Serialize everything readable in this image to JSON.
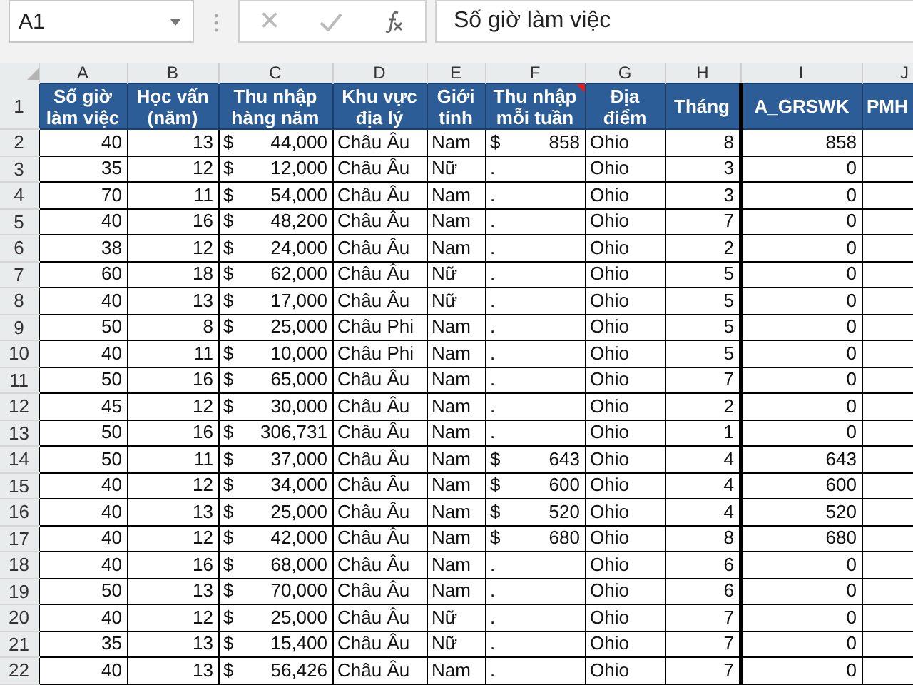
{
  "formula_bar": {
    "name_box": "A1",
    "cancel_icon": "×",
    "formula": "Số giờ làm việc"
  },
  "columns": [
    {
      "letter": "A",
      "heading": "Số giờ làm việc",
      "kind": "number"
    },
    {
      "letter": "B",
      "heading": "Học vấn (năm)",
      "kind": "number"
    },
    {
      "letter": "C",
      "heading": "Thu nhập hàng năm",
      "kind": "money"
    },
    {
      "letter": "D",
      "heading": "Khu vực địa lý",
      "kind": "text"
    },
    {
      "letter": "E",
      "heading": "Giới tính",
      "kind": "text"
    },
    {
      "letter": "F",
      "heading": "Thu nhập mỗi tuần",
      "kind": "money",
      "comment": true
    },
    {
      "letter": "G",
      "heading": "Địa điểm",
      "kind": "text"
    },
    {
      "letter": "H",
      "heading": "Tháng",
      "kind": "number"
    },
    {
      "letter": "I",
      "heading": "A_GRSWK",
      "kind": "number"
    },
    {
      "letter": "J",
      "heading": "PMH"
    }
  ],
  "header_row_number": "1",
  "rows": [
    {
      "num": "2",
      "cells": [
        [
          "40"
        ],
        [
          "13"
        ],
        [
          "$",
          "44,000"
        ],
        [
          "Châu Âu"
        ],
        [
          "Nam"
        ],
        [
          "$",
          "858"
        ],
        [
          "Ohio"
        ],
        [
          "8"
        ],
        [
          "858"
        ]
      ]
    },
    {
      "num": "3",
      "cells": [
        [
          "35"
        ],
        [
          "12"
        ],
        [
          "$",
          "12,000"
        ],
        [
          "Châu Âu"
        ],
        [
          "Nữ"
        ],
        [
          "."
        ],
        [
          "Ohio"
        ],
        [
          "3"
        ],
        [
          "0"
        ]
      ]
    },
    {
      "num": "4",
      "cells": [
        [
          "70"
        ],
        [
          "11"
        ],
        [
          "$",
          "54,000"
        ],
        [
          "Châu Âu"
        ],
        [
          "Nam"
        ],
        [
          "."
        ],
        [
          "Ohio"
        ],
        [
          "3"
        ],
        [
          "0"
        ]
      ]
    },
    {
      "num": "5",
      "cells": [
        [
          "40"
        ],
        [
          "16"
        ],
        [
          "$",
          "48,200"
        ],
        [
          "Châu Âu"
        ],
        [
          "Nam"
        ],
        [
          "."
        ],
        [
          "Ohio"
        ],
        [
          "7"
        ],
        [
          "0"
        ]
      ]
    },
    {
      "num": "6",
      "cells": [
        [
          "38"
        ],
        [
          "12"
        ],
        [
          "$",
          "24,000"
        ],
        [
          "Châu Âu"
        ],
        [
          "Nam"
        ],
        [
          "."
        ],
        [
          "Ohio"
        ],
        [
          "2"
        ],
        [
          "0"
        ]
      ]
    },
    {
      "num": "7",
      "cells": [
        [
          "60"
        ],
        [
          "18"
        ],
        [
          "$",
          "62,000"
        ],
        [
          "Châu Âu"
        ],
        [
          "Nữ"
        ],
        [
          "."
        ],
        [
          "Ohio"
        ],
        [
          "5"
        ],
        [
          "0"
        ]
      ]
    },
    {
      "num": "8",
      "cells": [
        [
          "40"
        ],
        [
          "13"
        ],
        [
          "$",
          "17,000"
        ],
        [
          "Châu Âu"
        ],
        [
          "Nữ"
        ],
        [
          "."
        ],
        [
          "Ohio"
        ],
        [
          "5"
        ],
        [
          "0"
        ]
      ]
    },
    {
      "num": "9",
      "cells": [
        [
          "50"
        ],
        [
          "8"
        ],
        [
          "$",
          "25,000"
        ],
        [
          "Châu Phi"
        ],
        [
          "Nam"
        ],
        [
          "."
        ],
        [
          "Ohio"
        ],
        [
          "5"
        ],
        [
          "0"
        ]
      ]
    },
    {
      "num": "10",
      "cells": [
        [
          "40"
        ],
        [
          "11"
        ],
        [
          "$",
          "10,000"
        ],
        [
          "Châu Phi"
        ],
        [
          "Nam"
        ],
        [
          "."
        ],
        [
          "Ohio"
        ],
        [
          "5"
        ],
        [
          "0"
        ]
      ]
    },
    {
      "num": "11",
      "cells": [
        [
          "50"
        ],
        [
          "16"
        ],
        [
          "$",
          "65,000"
        ],
        [
          "Châu Âu"
        ],
        [
          "Nam"
        ],
        [
          "."
        ],
        [
          "Ohio"
        ],
        [
          "7"
        ],
        [
          "0"
        ]
      ]
    },
    {
      "num": "12",
      "cells": [
        [
          "45"
        ],
        [
          "12"
        ],
        [
          "$",
          "30,000"
        ],
        [
          "Châu Âu"
        ],
        [
          "Nam"
        ],
        [
          "."
        ],
        [
          "Ohio"
        ],
        [
          "2"
        ],
        [
          "0"
        ]
      ]
    },
    {
      "num": "13",
      "cells": [
        [
          "50"
        ],
        [
          "16"
        ],
        [
          "$",
          "306,731"
        ],
        [
          "Châu Âu"
        ],
        [
          "Nam"
        ],
        [
          "."
        ],
        [
          "Ohio"
        ],
        [
          "1"
        ],
        [
          "0"
        ]
      ]
    },
    {
      "num": "14",
      "cells": [
        [
          "50"
        ],
        [
          "11"
        ],
        [
          "$",
          "37,000"
        ],
        [
          "Châu Âu"
        ],
        [
          "Nam"
        ],
        [
          "$",
          "643"
        ],
        [
          "Ohio"
        ],
        [
          "4"
        ],
        [
          "643"
        ]
      ]
    },
    {
      "num": "15",
      "cells": [
        [
          "40"
        ],
        [
          "12"
        ],
        [
          "$",
          "34,000"
        ],
        [
          "Châu Âu"
        ],
        [
          "Nam"
        ],
        [
          "$",
          "600"
        ],
        [
          "Ohio"
        ],
        [
          "4"
        ],
        [
          "600"
        ]
      ]
    },
    {
      "num": "16",
      "cells": [
        [
          "40"
        ],
        [
          "13"
        ],
        [
          "$",
          "25,000"
        ],
        [
          "Châu Âu"
        ],
        [
          "Nam"
        ],
        [
          "$",
          "520"
        ],
        [
          "Ohio"
        ],
        [
          "4"
        ],
        [
          "520"
        ]
      ]
    },
    {
      "num": "17",
      "cells": [
        [
          "40"
        ],
        [
          "12"
        ],
        [
          "$",
          "42,000"
        ],
        [
          "Châu Âu"
        ],
        [
          "Nam"
        ],
        [
          "$",
          "680"
        ],
        [
          "Ohio"
        ],
        [
          "8"
        ],
        [
          "680"
        ]
      ]
    },
    {
      "num": "18",
      "cells": [
        [
          "40"
        ],
        [
          "16"
        ],
        [
          "$",
          "68,000"
        ],
        [
          "Châu Âu"
        ],
        [
          "Nam"
        ],
        [
          "."
        ],
        [
          "Ohio"
        ],
        [
          "6"
        ],
        [
          "0"
        ]
      ]
    },
    {
      "num": "19",
      "cells": [
        [
          "50"
        ],
        [
          "13"
        ],
        [
          "$",
          "70,000"
        ],
        [
          "Châu Âu"
        ],
        [
          "Nam"
        ],
        [
          "."
        ],
        [
          "Ohio"
        ],
        [
          "6"
        ],
        [
          "0"
        ]
      ]
    },
    {
      "num": "20",
      "cells": [
        [
          "40"
        ],
        [
          "12"
        ],
        [
          "$",
          "25,000"
        ],
        [
          "Châu Âu"
        ],
        [
          "Nữ"
        ],
        [
          "."
        ],
        [
          "Ohio"
        ],
        [
          "7"
        ],
        [
          "0"
        ]
      ]
    },
    {
      "num": "21",
      "cells": [
        [
          "35"
        ],
        [
          "13"
        ],
        [
          "$",
          "15,400"
        ],
        [
          "Châu Âu"
        ],
        [
          "Nữ"
        ],
        [
          "."
        ],
        [
          "Ohio"
        ],
        [
          "7"
        ],
        [
          "0"
        ]
      ]
    },
    {
      "num": "22",
      "cells": [
        [
          "40"
        ],
        [
          "13"
        ],
        [
          "$",
          "56,426"
        ],
        [
          "Châu Âu"
        ],
        [
          "Nam"
        ],
        [
          "."
        ],
        [
          "Ohio"
        ],
        [
          "7"
        ],
        [
          "0"
        ]
      ]
    }
  ]
}
